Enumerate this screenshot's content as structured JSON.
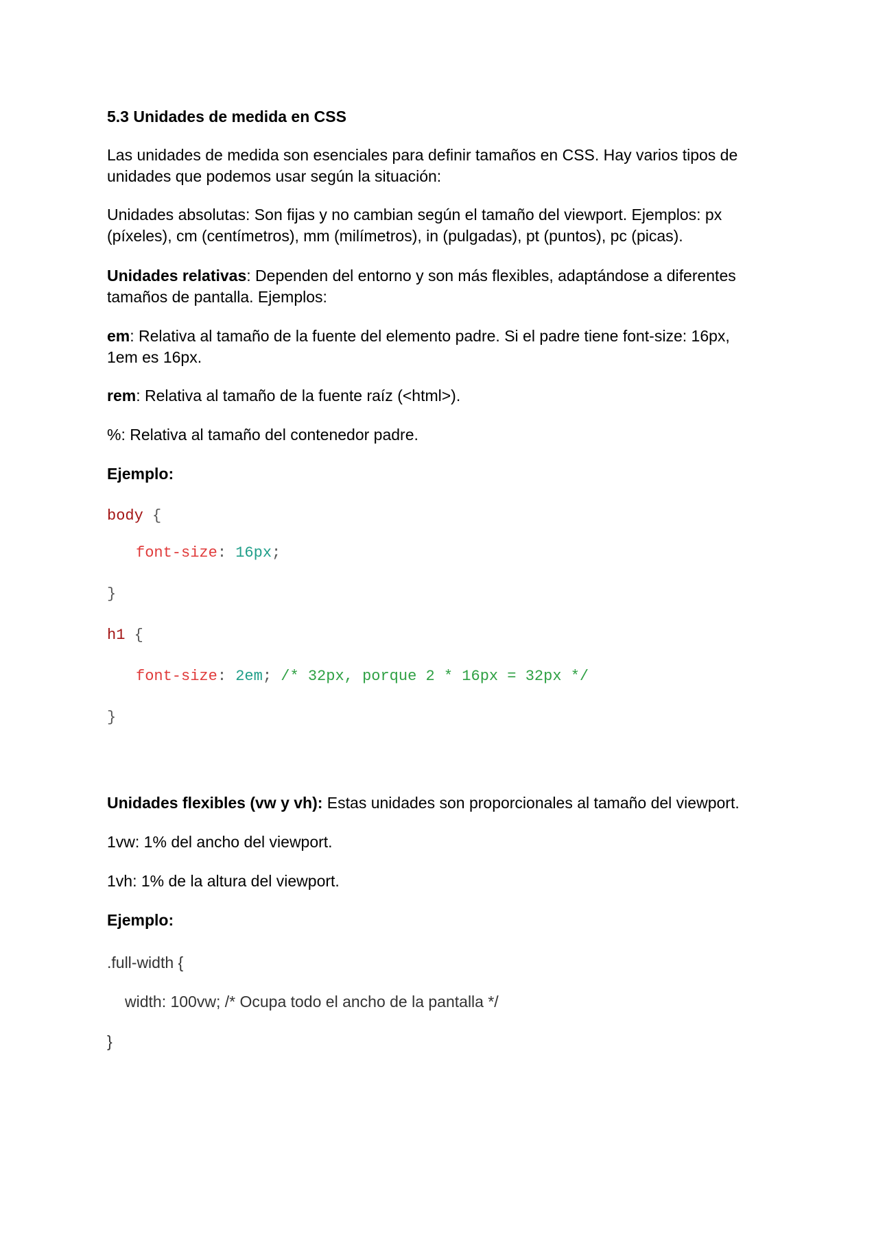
{
  "doc": {
    "heading": "5.3 Unidades de medida en CSS",
    "intro_line1": "Las unidades de medida son esenciales para definir tamaños en CSS. Hay varios tipos de",
    "intro_line2": "unidades que podemos usar según la situación:",
    "abs_line1": "Unidades absolutas: Son fijas y no cambian según el tamaño del viewport. Ejemplos: px",
    "abs_line2": "(píxeles), cm (centímetros), mm (milímetros), in (pulgadas), pt (puntos), pc (picas).",
    "rel_label": "Unidades relativas",
    "rel_rest": ": Dependen del entorno y son más flexibles, adaptándose a diferentes",
    "rel_line2": "tamaños de pantalla. Ejemplos:",
    "em_label": "em",
    "em_rest": ": Relativa al tamaño de la fuente del elemento padre. Si el padre tiene font-size: 16px,",
    "em_line2": "1em es 16px.",
    "rem_label": "rem",
    "rem_rest": ": Relativa al tamaño de la fuente raíz (<html>).",
    "pct_line": "%: Relativa al tamaño del contenedor padre.",
    "example1_label": "Ejemplo:",
    "code1": {
      "l1_sel": "body",
      "l1_brace": " {",
      "l2_prop": "font-size",
      "l2_colon": ": ",
      "l2_val": "16px",
      "l2_semi": ";",
      "l3": "}",
      "l4_sel": "h1",
      "l4_brace": " {",
      "l5_prop": "font-size",
      "l5_colon": ": ",
      "l5_val": "2em",
      "l5_semi": "; ",
      "l5_comment": "/* 32px, porque 2 * 16px = 32px */",
      "l6": "}"
    },
    "flex_label": "Unidades flexibles (vw y vh):",
    "flex_rest": " Estas unidades son proporcionales al tamaño del viewport.",
    "vw_line": "1vw: 1% del ancho del viewport.",
    "vh_line": "1vh: 1% de la altura del viewport.",
    "example2_label": "Ejemplo:",
    "code2": {
      "l1": ".full-width {",
      "l2": "width: 100vw; /* Ocupa todo el ancho de la pantalla */",
      "l3": "}"
    }
  }
}
